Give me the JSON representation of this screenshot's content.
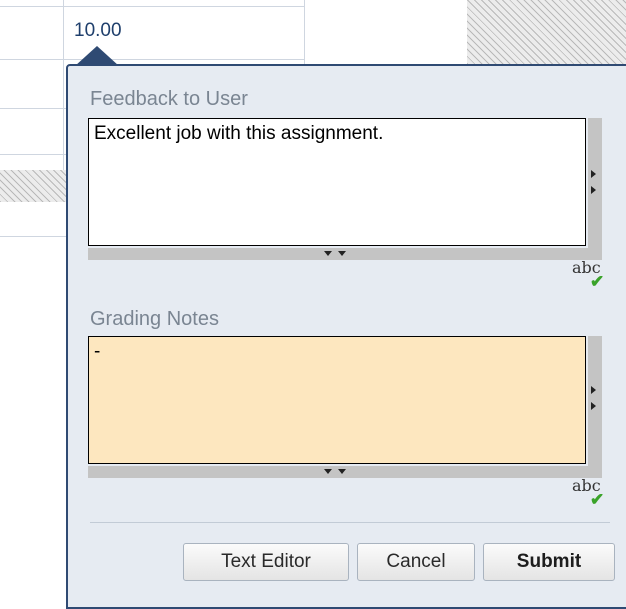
{
  "grade_cell": {
    "value": "10.00"
  },
  "feedback": {
    "label": "Feedback to User",
    "value": "Excellent job with this assignment.",
    "spellcheck_label": "abc",
    "spellcheck_mark": "✔"
  },
  "notes": {
    "label": "Grading Notes",
    "value": "-",
    "spellcheck_label": "abc",
    "spellcheck_mark": "✔"
  },
  "buttons": {
    "text_editor": "Text Editor",
    "cancel": "Cancel",
    "submit": "Submit"
  },
  "colors": {
    "popup_background": "#e6ebf2",
    "popup_border": "#2f4a73",
    "notes_background": "#fde7bf",
    "check_green": "#3aa32a"
  },
  "icons": {
    "resize_right": "triangle-right",
    "resize_down": "triangle-down",
    "spellcheck": "abc-checkmark"
  }
}
